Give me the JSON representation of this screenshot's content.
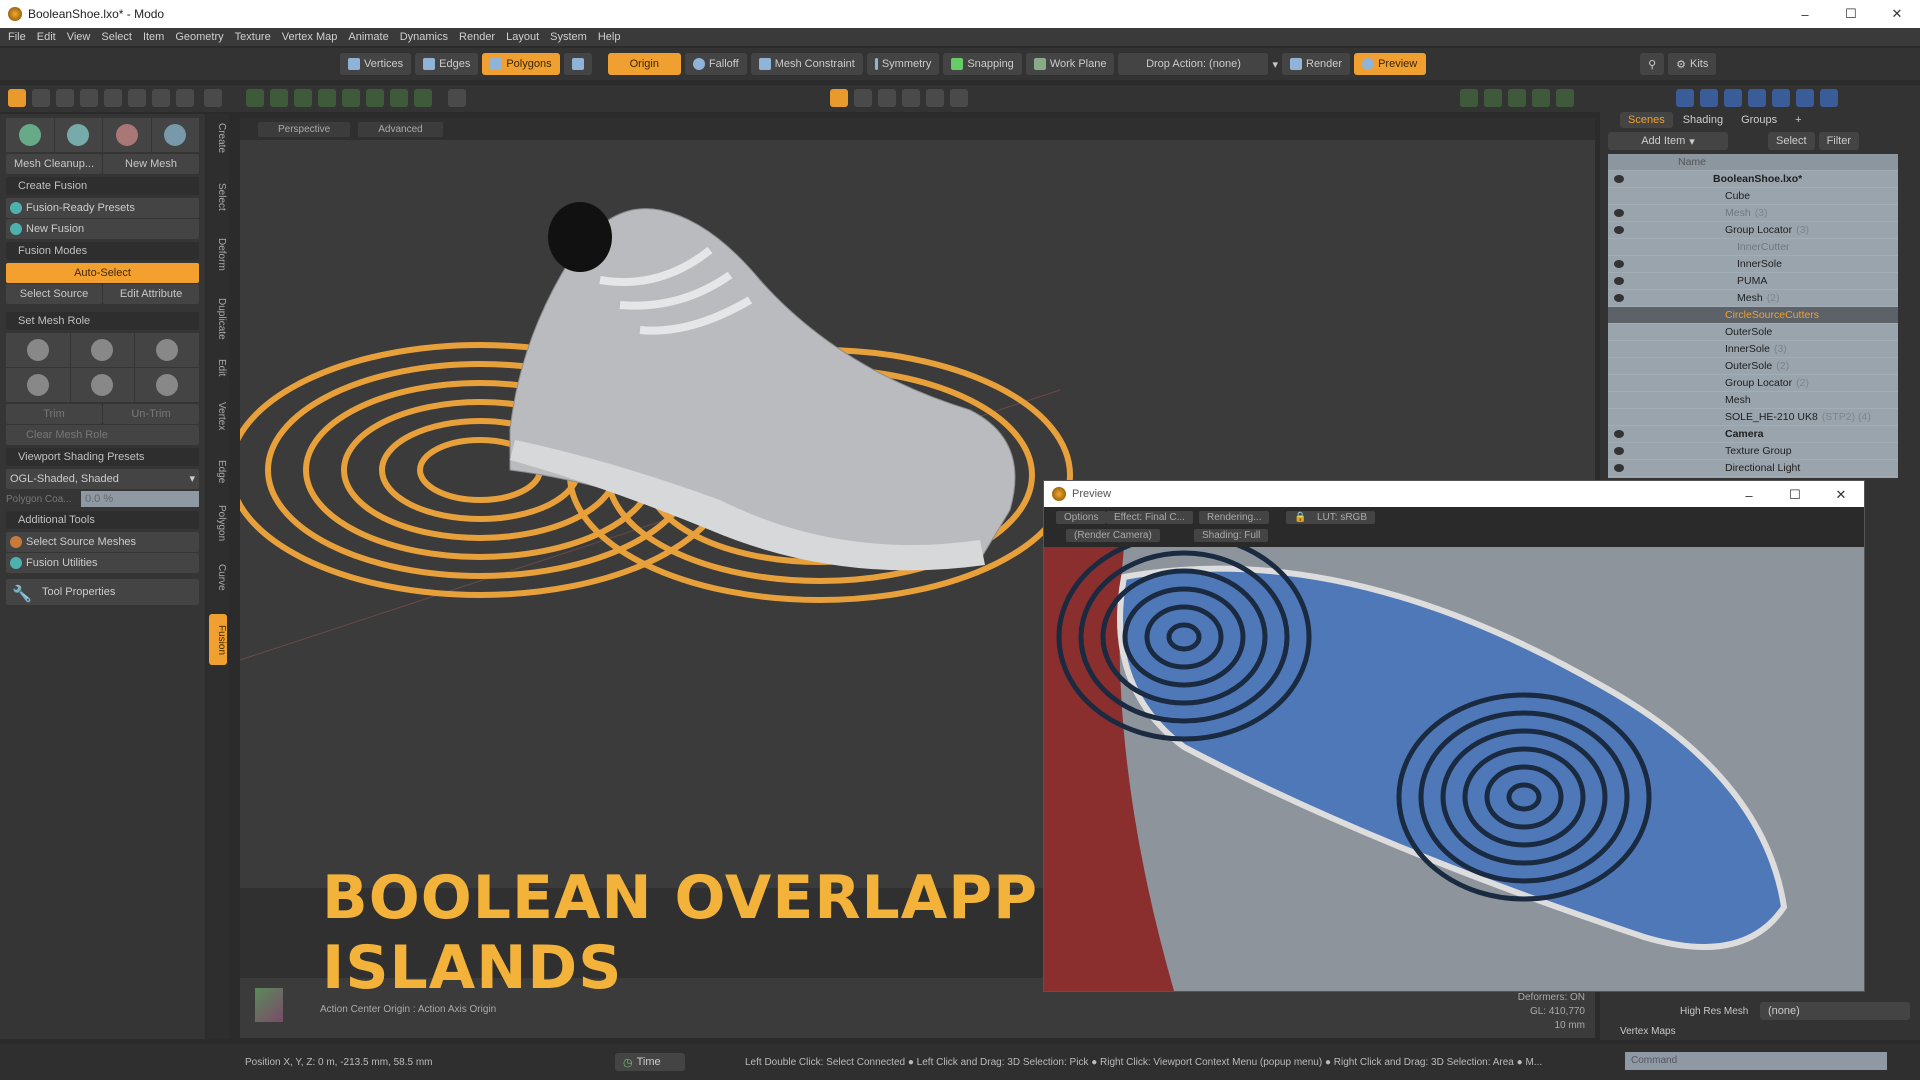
{
  "window": {
    "title": "BooleanShoe.lxo* - Modo",
    "min": "–",
    "max": "☐",
    "close": "✕"
  },
  "menu": [
    "File",
    "Edit",
    "View",
    "Select",
    "Item",
    "Geometry",
    "Texture",
    "Vertex Map",
    "Animate",
    "Dynamics",
    "Render",
    "Layout",
    "System",
    "Help"
  ],
  "toolbar": {
    "vertices": "Vertices",
    "edges": "Edges",
    "polygons": "Polygons",
    "origin": "Origin",
    "falloff": "Falloff",
    "mesh_constraint": "Mesh Constraint",
    "symmetry": "Symmetry",
    "snapping": "Snapping",
    "work_plane": "Work Plane",
    "drop_action": "Drop Action: (none)",
    "render": "Render",
    "preview": "Preview",
    "kits": "Kits"
  },
  "left_panel": {
    "mesh_cleanup": "Mesh Cleanup...",
    "new_mesh": "New Mesh",
    "create_fusion": "Create Fusion",
    "fusion_ready_presets": "Fusion-Ready Presets",
    "new_fusion": "New Fusion",
    "fusion_modes": "Fusion Modes",
    "auto_select": "Auto-Select",
    "select_source": "Select Source",
    "edit_attribute": "Edit Attribute",
    "set_mesh_role": "Set Mesh Role",
    "trim": "Trim",
    "untrim": "Un-Trim",
    "clear_mesh_role": "Clear Mesh Role",
    "viewport_shading_presets": "Viewport Shading Presets",
    "shading_value": "OGL-Shaded, Shaded",
    "polygon_label": "Polygon Coa...",
    "polygon_value": "0.0 %",
    "additional_tools": "Additional Tools",
    "select_source_meshes": "Select Source Meshes",
    "fusion_utilities": "Fusion Utilities",
    "tool_properties": "Tool Properties"
  },
  "vertical_tabs": [
    "Create",
    "Select",
    "Deform",
    "Duplicate",
    "Edit",
    "Vertex",
    "Edge",
    "Polygon",
    "Curve",
    "Fusion"
  ],
  "viewport": {
    "view": "Perspective",
    "mode": "Advanced",
    "action_center": "Action Center Origin : Action Axis Origin",
    "deformers": "Deformers: ON",
    "gl": "GL: 410,770",
    "scale": "10 mm"
  },
  "caption": "BOOLEAN OVERLAPPING MESH ISLANDS",
  "colors": {
    "accent": "#f0a030",
    "caption": "#f3b23a",
    "rings": "#e8a03a",
    "sole_blue": "#4f78b8"
  },
  "scene": {
    "tabs": [
      "Scenes",
      "Shading",
      "Groups",
      "+"
    ],
    "add_item": "Add Item",
    "select": "Select",
    "filter": "Filter",
    "name_header": "Name",
    "items": [
      {
        "name": "BooleanShoe.lxo*",
        "count": "",
        "depth": 0,
        "eye": true,
        "bold": true
      },
      {
        "name": "Cube",
        "count": "",
        "depth": 1,
        "eye": false
      },
      {
        "name": "Mesh",
        "count": "(3)",
        "depth": 1,
        "eye": true,
        "faint": true
      },
      {
        "name": "Group Locator",
        "count": "(3)",
        "depth": 1,
        "eye": true
      },
      {
        "name": "InnerCutter",
        "count": "",
        "depth": 2,
        "eye": false,
        "faint": true
      },
      {
        "name": "InnerSole",
        "count": "",
        "depth": 2,
        "eye": true
      },
      {
        "name": "PUMA",
        "count": "",
        "depth": 2,
        "eye": true
      },
      {
        "name": "Mesh",
        "count": "(2)",
        "depth": 2,
        "eye": true
      },
      {
        "name": "CircleSourceCutters",
        "count": "",
        "depth": 1,
        "eye": false,
        "selected": true
      },
      {
        "name": "OuterSole",
        "count": "",
        "depth": 1,
        "eye": false
      },
      {
        "name": "InnerSole",
        "count": "(3)",
        "depth": 1,
        "eye": false
      },
      {
        "name": "OuterSole",
        "count": "(2)",
        "depth": 1,
        "eye": false
      },
      {
        "name": "Group Locator",
        "count": "(2)",
        "depth": 1,
        "eye": false
      },
      {
        "name": "Mesh",
        "count": "",
        "depth": 1,
        "eye": false
      },
      {
        "name": "SOLE_HE-210 UK8",
        "count": "(STP2) (4)",
        "depth": 1,
        "eye": false
      },
      {
        "name": "Camera",
        "count": "",
        "depth": 1,
        "eye": true,
        "bold": true
      },
      {
        "name": "Texture Group",
        "count": "",
        "depth": 1,
        "eye": true
      },
      {
        "name": "Directional Light",
        "count": "",
        "depth": 1,
        "eye": true
      }
    ],
    "high_res_mesh": "High Res Mesh",
    "high_res_value": "(none)",
    "vertex_maps": "Vertex Maps",
    "command": "Command"
  },
  "preview": {
    "title": "Preview",
    "options": "Options",
    "effect": "Effect: Final C...",
    "rendering": "Rendering...",
    "lut": "LUT: sRGB",
    "camera": "(Render Camera)",
    "shading": "Shading: Full"
  },
  "status": {
    "position": "Position X, Y, Z:  0 m, -213.5 mm, 58.5 mm",
    "time": "Time",
    "hints": "Left Double Click: Select Connected ● Left Click and Drag: 3D Selection: Pick ● Right Click: Viewport Context Menu (popup menu) ● Right Click and Drag: 3D Selection: Area ● M..."
  }
}
